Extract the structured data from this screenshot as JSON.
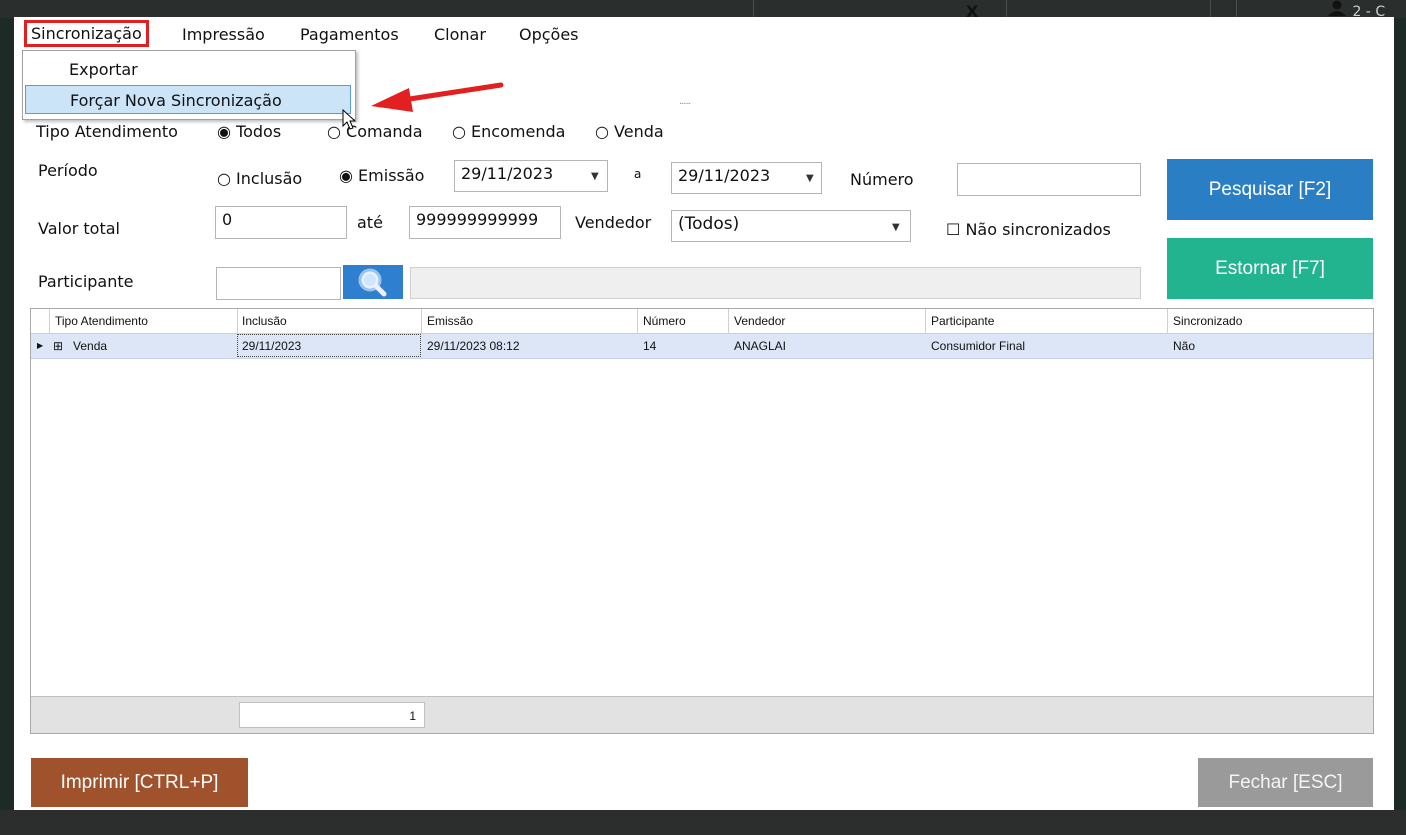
{
  "colors": {
    "menu_highlight": "#e02020",
    "pesquisar_bg": "#2a7fc4",
    "estornar_bg": "#22b48e",
    "imprimir_bg": "#a0522d",
    "fechar_bg": "#9a9a9a",
    "row_selected_bg": "#dde6f7"
  },
  "background": {
    "top_icon": "X",
    "top_user": "2 - C"
  },
  "menubar": {
    "items": [
      {
        "label": "Sincronização"
      },
      {
        "label": "Impressão"
      },
      {
        "label": "Pagamentos"
      },
      {
        "label": "Clonar"
      },
      {
        "label": "Opções"
      }
    ]
  },
  "dropdown": {
    "items": [
      {
        "label": "Exportar"
      },
      {
        "label": "Forçar Nova Sincronização"
      }
    ]
  },
  "filters": {
    "tipo_label": "Tipo Atendimento",
    "tipo_options": [
      "Todos",
      "Comanda",
      "Encomenda",
      "Venda"
    ],
    "tipo_selected": "Todos",
    "periodo_label": "Período",
    "periodo_options": [
      "Inclusão",
      "Emissão"
    ],
    "periodo_selected": "Emissão",
    "date_from": "29/11/2023",
    "date_sep": "a",
    "date_to": "29/11/2023",
    "numero_label": "Número",
    "numero_value": "",
    "valor_label": "Valor total",
    "valor_min": "0",
    "ate_label": "até",
    "valor_max": "999999999999",
    "vendedor_label": "Vendedor",
    "vendedor_value": "(Todos)",
    "nao_sinc_label": "Não sincronizados",
    "participante_label": "Participante",
    "participante_code": "",
    "participante_name": ""
  },
  "buttons": {
    "pesquisar": "Pesquisar [F2]",
    "estornar": "Estornar [F7]",
    "imprimir": "Imprimir [CTRL+P]",
    "fechar": "Fechar [ESC]"
  },
  "grid": {
    "columns": [
      "Tipo Atendimento",
      "Inclusão",
      "Emissão",
      "Número",
      "Vendedor",
      "Participante",
      "Sincronizado"
    ],
    "rows": [
      [
        "Venda",
        "29/11/2023",
        "29/11/2023 08:12",
        "14",
        "ANAGLAI",
        "Consumidor Final",
        "Não"
      ]
    ],
    "footer_count": "1"
  }
}
